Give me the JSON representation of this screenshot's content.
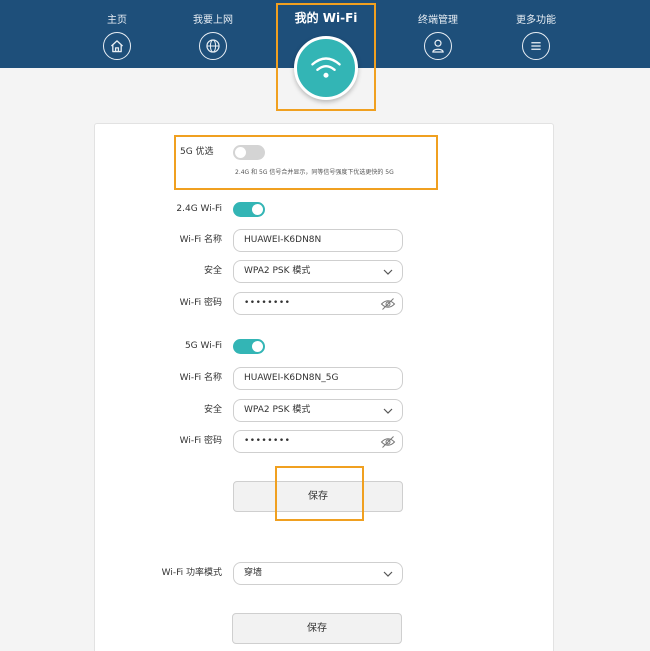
{
  "nav": {
    "items": [
      {
        "label": "主页",
        "icon": "home-icon"
      },
      {
        "label": "我要上网",
        "icon": "globe-icon"
      },
      {
        "label": "终端管理",
        "icon": "user-icon"
      },
      {
        "label": "更多功能",
        "icon": "menu-icon"
      }
    ],
    "active": {
      "label": "我的 Wi-Fi",
      "icon": "wifi-icon"
    }
  },
  "colors": {
    "header": "#1e4f7a",
    "accent": "#33b5b5",
    "highlight": "#f0a020"
  },
  "priority5g": {
    "label": "5G 优选",
    "enabled": false,
    "note": "2.4G 和 5G 信号合并显示，同等信号强度下优选更快的 5G"
  },
  "wifi24": {
    "toggle_label": "2.4G Wi-Fi",
    "enabled": true,
    "name_label": "Wi-Fi 名称",
    "name_value": "HUAWEI-K6DN8N",
    "security_label": "安全",
    "security_value": "WPA2 PSK 模式",
    "password_label": "Wi-Fi 密码",
    "password_value": "••••••••"
  },
  "wifi5": {
    "toggle_label": "5G Wi-Fi",
    "enabled": true,
    "name_label": "Wi-Fi 名称",
    "name_value": "HUAWEI-K6DN8N_5G",
    "security_label": "安全",
    "security_value": "WPA2 PSK 模式",
    "password_label": "Wi-Fi 密码",
    "password_value": "••••••••"
  },
  "save_label": "保存",
  "power": {
    "label": "Wi-Fi 功率模式",
    "value": "穿墙"
  },
  "save2_label": "保存"
}
